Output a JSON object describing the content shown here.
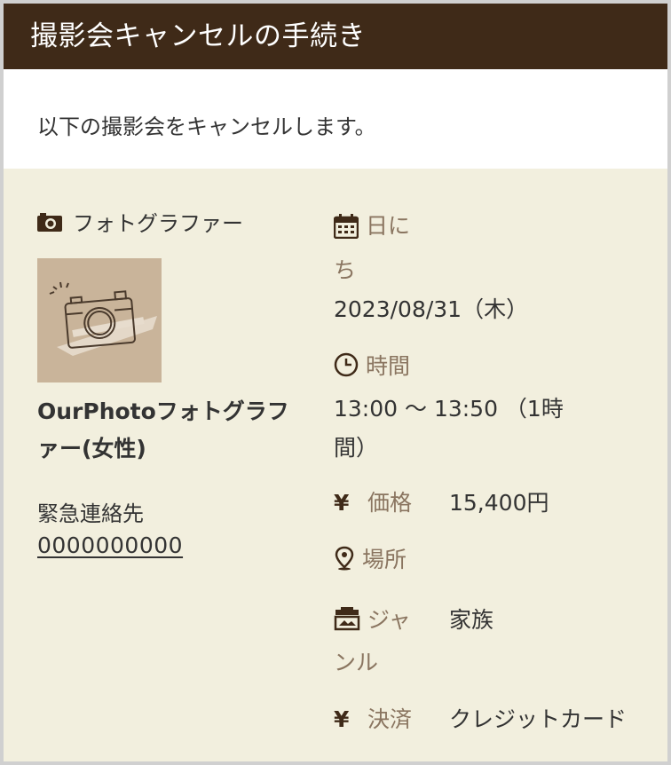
{
  "header": {
    "title": "撮影会キャンセルの手続き"
  },
  "intro": {
    "text": "以下の撮影会をキャンセルします。"
  },
  "photographer": {
    "label": "フォトグラファー",
    "icon": "camera-icon",
    "name_line1": "OurPhotoフォトグラフ",
    "name_line2": "ァー(女性)",
    "emergency_label": "緊急連絡先",
    "emergency_value": "0000000000"
  },
  "details": {
    "date": {
      "label_line1": "日に",
      "label_line2": "ち",
      "value": "2023/08/31（木）",
      "icon": "calendar-icon"
    },
    "time": {
      "label": "時間",
      "value_line1": "13:00 〜 13:50 （1時",
      "value_line2": "間）",
      "icon": "clock-icon"
    },
    "price": {
      "label": "価格",
      "value": "15,400円",
      "icon": "yen-icon"
    },
    "place": {
      "label": "場所",
      "value": "",
      "icon": "map-pin-icon"
    },
    "genre": {
      "label_line1": "ジャ",
      "label_line2": "ンル",
      "value": "家族",
      "icon": "genre-icon"
    },
    "payment": {
      "label": "決済",
      "value": "クレジットカード",
      "icon": "yen-icon"
    }
  },
  "colors": {
    "header_bg": "#3f2a18",
    "content_bg": "#f2efde",
    "label_brown": "#8a7560",
    "photo_bg": "#c9b49a"
  }
}
